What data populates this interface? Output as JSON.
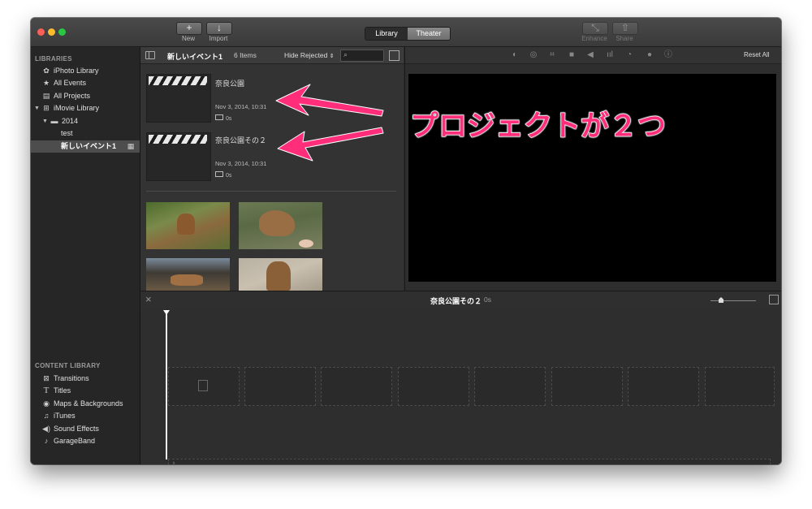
{
  "toolbar": {
    "new_label": "New",
    "new_glyph": "+",
    "import_label": "Import",
    "import_glyph": "↓",
    "tab_library": "Library",
    "tab_theater": "Theater",
    "enhance_label": "Enhance",
    "enhance_glyph": "⤡",
    "share_label": "Share",
    "share_glyph": "⇧"
  },
  "sidebar": {
    "libraries_header": "LIBRARIES",
    "items": [
      {
        "label": "iPhoto Library",
        "icon": "photo-icon"
      },
      {
        "label": "All Events",
        "icon": "star-icon"
      },
      {
        "label": "All Projects",
        "icon": "projects-icon"
      },
      {
        "label": "iMovie Library",
        "icon": "grid-icon"
      },
      {
        "label": "2014",
        "icon": "folder-icon"
      },
      {
        "label": "test",
        "icon": ""
      },
      {
        "label": "新しいイベント1",
        "icon": "clapper-icon"
      }
    ],
    "content_header": "CONTENT LIBRARY",
    "content_items": [
      {
        "label": "Transitions",
        "icon": "transitions-icon"
      },
      {
        "label": "Titles",
        "icon": "titles-icon"
      },
      {
        "label": "Maps & Backgrounds",
        "icon": "globe-icon"
      },
      {
        "label": "iTunes",
        "icon": "music-note-icon"
      },
      {
        "label": "Sound Effects",
        "icon": "speaker-icon"
      },
      {
        "label": "GarageBand",
        "icon": "guitar-icon"
      }
    ]
  },
  "browser": {
    "event_name": "新しいイベント1",
    "items_count": "6 Items",
    "filter": "Hide Rejected",
    "projects": [
      {
        "title": "奈良公園",
        "date": "Nov 3, 2014, 10:31",
        "duration": "0s"
      },
      {
        "title": "奈良公園その２",
        "date": "Nov 3, 2014, 10:31",
        "duration": "0s"
      }
    ],
    "clips": [
      "deer-clip-1",
      "deer-clip-2",
      "deer-clip-3",
      "deer-clip-4"
    ]
  },
  "viewer": {
    "reset_all": "Reset All"
  },
  "timeline": {
    "project_title": "奈良公園その２",
    "duration": "0s"
  },
  "annotation": {
    "text": "プロジェクトが２つ",
    "color": "#ff2d7a"
  },
  "colors": {
    "window_bg": "#2b2b2b",
    "sidebar_bg": "#262626",
    "selected_row": "#4d4d4d",
    "accent_pink": "#ff2d7a"
  }
}
